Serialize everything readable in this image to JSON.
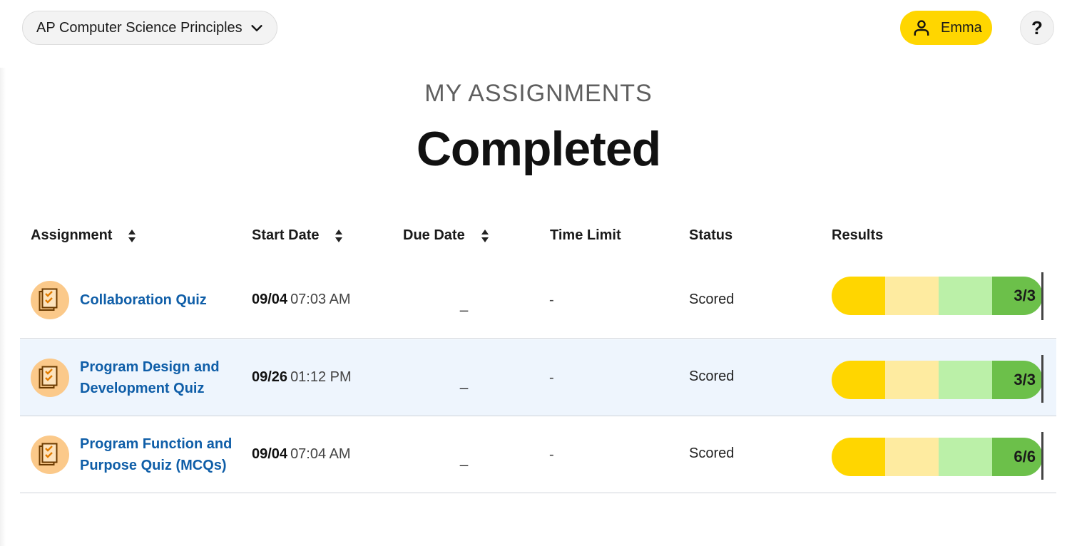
{
  "header": {
    "course_label": "AP Computer Science Principles",
    "user_name": "Emma",
    "help_label": "?"
  },
  "page": {
    "eyebrow": "MY ASSIGNMENTS",
    "title": "Completed"
  },
  "columns": [
    "Assignment",
    "Start Date",
    "Due Date",
    "Time Limit",
    "Status",
    "Results"
  ],
  "colors": {
    "accent_yellow": "#ffd600",
    "link_blue": "#0f5ea8",
    "row_highlight": "#eef5fd",
    "result_segments": [
      "#ffd600",
      "#feeba0",
      "#bbf0a8",
      "#6cc04a"
    ]
  },
  "rows": [
    {
      "title_lines": [
        "Collaboration Quiz"
      ],
      "start_date": "09/04",
      "start_time": "07:03 AM",
      "due_date": "_",
      "time_limit": "-",
      "status": "Scored",
      "result": "3/3",
      "icon": "quiz-checklist-icon"
    },
    {
      "title_lines": [
        "Program Design and",
        "Development Quiz"
      ],
      "start_date": "09/26",
      "start_time": "01:12 PM",
      "due_date": "_",
      "time_limit": "-",
      "status": "Scored",
      "result": "3/3",
      "icon": "quiz-checklist-icon"
    },
    {
      "title_lines": [
        "Program Function and",
        "Purpose Quiz (MCQs)"
      ],
      "start_date": "09/04",
      "start_time": "07:04 AM",
      "due_date": "_",
      "time_limit": "-",
      "status": "Scored",
      "result": "6/6",
      "icon": "quiz-checklist-icon"
    }
  ]
}
